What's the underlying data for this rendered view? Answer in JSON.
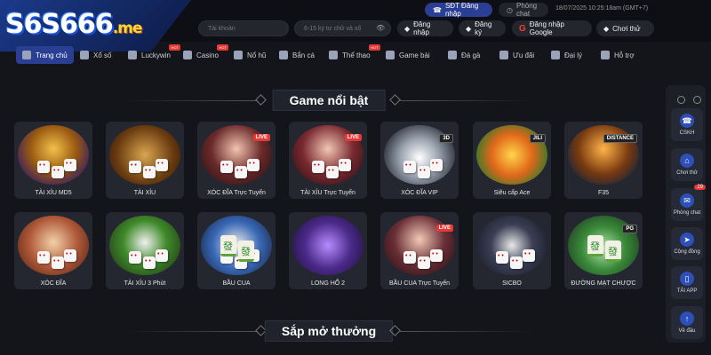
{
  "brand": {
    "logo": "S6S666",
    "logo_tld": ".me"
  },
  "top": {
    "sdt_login": "SĐT Đăng nhập",
    "chat_room": "Phòng chat",
    "datetime": "18/07/2025 10:25:18am",
    "timezone": "(GMT+7)"
  },
  "auth": {
    "username_placeholder": "Tài khoản",
    "password_placeholder": "6-15 ký tự chữ và số",
    "login": "Đăng nhập",
    "register": "Đăng ký",
    "google_login": "Đăng nhập Google",
    "try_play": "Chơi thử"
  },
  "nav": [
    {
      "label": "Trang chủ",
      "icon": "home-icon",
      "hot": false
    },
    {
      "label": "Xổ số",
      "icon": "lottery-icon",
      "hot": false
    },
    {
      "label": "Luckywin",
      "icon": "luckywin-icon",
      "hot": true
    },
    {
      "label": "Casino",
      "icon": "casino-icon",
      "hot": true
    },
    {
      "label": "Nổ hũ",
      "icon": "slots-icon",
      "hot": false
    },
    {
      "label": "Bắn cá",
      "icon": "fish-icon",
      "hot": false
    },
    {
      "label": "Thể thao",
      "icon": "sports-icon",
      "hot": true
    },
    {
      "label": "Game bài",
      "icon": "cards-icon",
      "hot": false
    },
    {
      "label": "Đá gà",
      "icon": "rooster-icon",
      "hot": false
    },
    {
      "label": "Ưu đãi",
      "icon": "gift-icon",
      "hot": false
    },
    {
      "label": "Đại lý",
      "icon": "agent-icon",
      "hot": false
    },
    {
      "label": "Hỗ trợ",
      "icon": "support-icon",
      "hot": false
    }
  ],
  "hot_tag": "HOT",
  "sections": {
    "featured": "Game nổi bật",
    "upcoming": "Sắp mở thưởng"
  },
  "games_row1": [
    {
      "label": "TÀI XỈU MD5",
      "tag": ""
    },
    {
      "label": "TÀI XỈU",
      "tag": ""
    },
    {
      "label": "XÓC ĐĨA Trực Tuyến",
      "tag": "LIVE"
    },
    {
      "label": "TÀI XỈU Trực Tuyến",
      "tag": "LIVE"
    },
    {
      "label": "XÓC ĐĨA VIP",
      "tag": "3D"
    },
    {
      "label": "Siêu cấp Ace",
      "tag": "JILI"
    },
    {
      "label": "F35",
      "tag": "DISTANCE"
    }
  ],
  "games_row2": [
    {
      "label": "XÓC ĐĨA",
      "tag": ""
    },
    {
      "label": "TÀI XỈU 3 Phút",
      "tag": ""
    },
    {
      "label": "BẦU CUA",
      "tag": ""
    },
    {
      "label": "LONG HỔ 2",
      "tag": ""
    },
    {
      "label": "BẦU CUA Trực Tuyến",
      "tag": "LIVE"
    },
    {
      "label": "SICBO",
      "tag": ""
    },
    {
      "label": "ĐƯỜNG MẠT CHƯỢC",
      "tag": "PG"
    }
  ],
  "sidebar": [
    {
      "label": "CSKH",
      "icon": "headset-icon",
      "badge": ""
    },
    {
      "label": "Chơi thử",
      "icon": "gamepad-icon",
      "badge": ""
    },
    {
      "label": "Phòng chat",
      "icon": "chat-icon",
      "badge": "29"
    },
    {
      "label": "Cộng đồng",
      "icon": "telegram-icon",
      "badge": ""
    },
    {
      "label": "TẢI APP",
      "icon": "mobile-icon",
      "badge": ""
    },
    {
      "label": "Về đầu",
      "icon": "arrow-up-icon",
      "badge": ""
    }
  ],
  "colors": {
    "bg": "#14151b",
    "accent": "#2a3e93",
    "hot": "#e53935",
    "card": "#252730"
  }
}
